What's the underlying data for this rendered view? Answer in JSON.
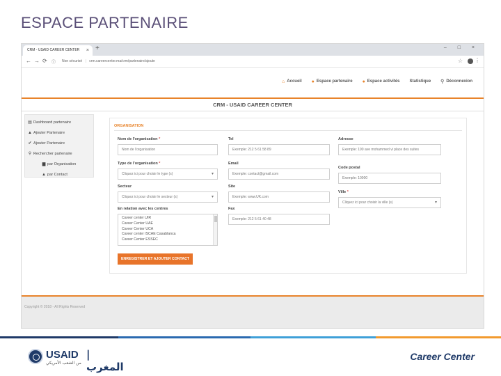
{
  "slide": {
    "title": "ESPACE PARTENAIRE"
  },
  "browser": {
    "tab_title": "CRM - USAID CAREER CENTER",
    "tab_close": "×",
    "new_tab": "+",
    "url_security": "Non sécurisé",
    "url": "crm.careercenter.ma/crm/partenaire/ajoute",
    "window_controls": "– □ ×"
  },
  "app_nav": {
    "items": [
      {
        "label": "Accueil",
        "icon": "home-icon",
        "glyph": "⌂"
      },
      {
        "label": "Espace partenaire",
        "icon": "partner-icon",
        "glyph": "●"
      },
      {
        "label": "Espace activités",
        "icon": "activities-icon",
        "glyph": "●"
      },
      {
        "label": "Statistique",
        "icon": "statistics-icon",
        "glyph": ""
      },
      {
        "label": "Déconnexion",
        "icon": "logout-icon",
        "glyph": "⚲"
      }
    ]
  },
  "crm_title": "CRM - USAID CAREER CENTER",
  "sidebar": {
    "items": [
      {
        "label": "Dashboard partenaire",
        "glyph": "▤"
      },
      {
        "label": "Ajouter Partenaire",
        "glyph": "▲"
      },
      {
        "label": "Ajouter Partenaire",
        "glyph": "✔"
      },
      {
        "label": "Rechercher partenaire",
        "glyph": "⚲"
      }
    ],
    "sub_items": [
      {
        "label": "par Organisation",
        "glyph": "▆"
      },
      {
        "label": "par Contact",
        "glyph": "▲"
      }
    ]
  },
  "form": {
    "heading": "ORGANISATION",
    "required_mark": "*",
    "nom": {
      "label": "Nom de l'organisation",
      "placeholder": "Nom de l'organisation"
    },
    "type": {
      "label": "Type de l'organisation",
      "value": "Cliquez ici pour choisir le type (s)"
    },
    "secteur": {
      "label": "Secteur",
      "value": "Cliquez ici pour choisir le secteur (s)"
    },
    "relation": {
      "label": "En relation avec les centres",
      "options": [
        "Career center UIR",
        "Career Center UAE",
        "Career Center UCA",
        "Career center ISCAE Casablanca",
        "Career Center ESSEC"
      ]
    },
    "tel": {
      "label": "Tel",
      "placeholder": "Exemple: 212 5 61 58 89"
    },
    "email": {
      "label": "Email",
      "placeholder": "Exemple: contact@gmail.com"
    },
    "site": {
      "label": "Site",
      "placeholder": "Exemple: www.UK.com"
    },
    "fax": {
      "label": "Fax",
      "placeholder": "Exemple: 212 5 61 40 48"
    },
    "adresse": {
      "label": "Adresse",
      "placeholder": "Exemple: 190 ave mohammed vi place des suites"
    },
    "code_postal": {
      "label": "Code postal",
      "placeholder": "Exemple: 10000"
    },
    "ville": {
      "label": "Ville",
      "value": "Cliquez ici pour choisir la ville (s)"
    },
    "submit_label": "ENREGISTRER ET AJOUTER CONTACT"
  },
  "footer": {
    "text": "Copyright © 2018 - All Rights Reserved"
  },
  "logos": {
    "usaid_word": "USAID",
    "usaid_arabic": "| المغرب",
    "usaid_subtitle": "من الشعب الأمريكي",
    "career_center": "Career Center"
  },
  "colors": {
    "accent": "#e8832a",
    "brand_navy": "#1f3a68",
    "bar_blue": "#2a6ab0",
    "bar_light_blue": "#3fa0d8",
    "bar_orange": "#f29a2e"
  }
}
